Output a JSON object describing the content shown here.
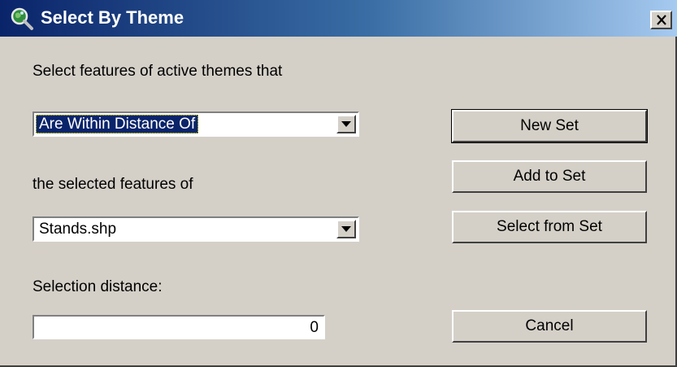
{
  "window": {
    "title": "Select By Theme",
    "close_glyph": "✕"
  },
  "labels": {
    "select_features": "Select features of active themes that",
    "selected_features_of": "the selected features of",
    "selection_distance": "Selection distance:"
  },
  "relation_combo": {
    "selected": "Are Within Distance Of"
  },
  "theme_combo": {
    "selected": "Stands.shp"
  },
  "distance_field": {
    "value": "0"
  },
  "buttons": {
    "new_set": "New Set",
    "add_to_set": "Add to Set",
    "select_from_set": "Select from Set",
    "cancel": "Cancel"
  },
  "colors": {
    "title_gradient_start": "#0a246a",
    "title_gradient_end": "#a6caf0",
    "face": "#d4d0c8",
    "selection": "#0a246a"
  },
  "icons": {
    "title": "magnifier-globe-icon",
    "dropdown": "triangle-down-icon"
  }
}
